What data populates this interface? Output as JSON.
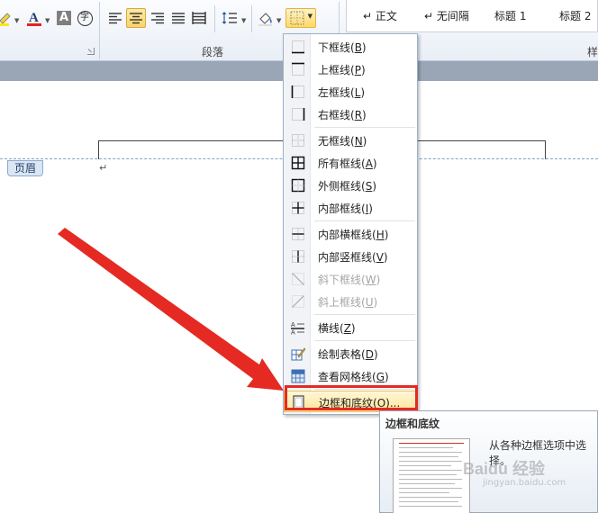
{
  "ribbon": {
    "font_group": {
      "highlight_icon": "highlighter-icon",
      "font_color_icon": "font-color-icon",
      "font_color_glyph": "A",
      "char_shading_glyph": "A",
      "enclose_glyph": "字"
    },
    "paragraph_group": {
      "label": "段落",
      "buttons": [
        "align-left-icon",
        "align-center-icon",
        "align-right-icon",
        "justify-icon",
        "distributed-icon",
        "line-spacing-icon",
        "shading-icon",
        "borders-icon"
      ],
      "active_button": "align-center-icon",
      "open_button": "borders-icon"
    },
    "styles": {
      "items": [
        "↵ 正文",
        "↵ 无间隔",
        "标题 1",
        "标题 2"
      ],
      "label_partial": "样"
    }
  },
  "document": {
    "header_tag": "页眉",
    "paragraph_mark": "↵"
  },
  "borders_menu": {
    "items": [
      {
        "label": "下框线(",
        "key": "B",
        "suffix": ")",
        "icon": "bottom-border-icon",
        "disabled": false
      },
      {
        "label": "上框线(",
        "key": "P",
        "suffix": ")",
        "icon": "top-border-icon",
        "disabled": false
      },
      {
        "label": "左框线(",
        "key": "L",
        "suffix": ")",
        "icon": "left-border-icon",
        "disabled": false
      },
      {
        "label": "右框线(",
        "key": "R",
        "suffix": ")",
        "icon": "right-border-icon",
        "disabled": false
      },
      {
        "label": "无框线(",
        "key": "N",
        "suffix": ")",
        "icon": "no-border-icon",
        "disabled": false
      },
      {
        "label": "所有框线(",
        "key": "A",
        "suffix": ")",
        "icon": "all-borders-icon",
        "disabled": false
      },
      {
        "label": "外侧框线(",
        "key": "S",
        "suffix": ")",
        "icon": "outside-borders-icon",
        "disabled": false
      },
      {
        "label": "内部框线(",
        "key": "I",
        "suffix": ")",
        "icon": "inside-borders-icon",
        "disabled": false
      },
      {
        "label": "内部横框线(",
        "key": "H",
        "suffix": ")",
        "icon": "inside-horizontal-border-icon",
        "disabled": false
      },
      {
        "label": "内部竖框线(",
        "key": "V",
        "suffix": ")",
        "icon": "inside-vertical-border-icon",
        "disabled": false
      },
      {
        "label": "斜下框线(",
        "key": "W",
        "suffix": ")",
        "icon": "diagonal-down-border-icon",
        "disabled": true
      },
      {
        "label": "斜上框线(",
        "key": "U",
        "suffix": ")",
        "icon": "diagonal-up-border-icon",
        "disabled": true
      },
      {
        "label": "横线(",
        "key": "Z",
        "suffix": ")",
        "icon": "horizontal-line-icon",
        "disabled": false
      },
      {
        "label": "绘制表格(",
        "key": "D",
        "suffix": ")",
        "icon": "draw-table-icon",
        "disabled": false
      },
      {
        "label": "查看网格线(",
        "key": "G",
        "suffix": ")",
        "icon": "view-gridlines-icon",
        "disabled": false
      },
      {
        "label": "边框和底纹(",
        "key": "O",
        "suffix": ")...",
        "icon": "borders-and-shading-icon",
        "disabled": false
      }
    ],
    "highlighted_item": "边框和底纹(O)..."
  },
  "tooltip": {
    "title": "边框和底纹",
    "description": "从各种边框选项中选择。",
    "watermark": "Baidu 经验",
    "watermark_url": "jingyan.baidu.com"
  },
  "colors": {
    "accent_red": "#e42a22",
    "menu_highlight": "#ffe59a",
    "ribbon_bg": "#e9eef6"
  }
}
